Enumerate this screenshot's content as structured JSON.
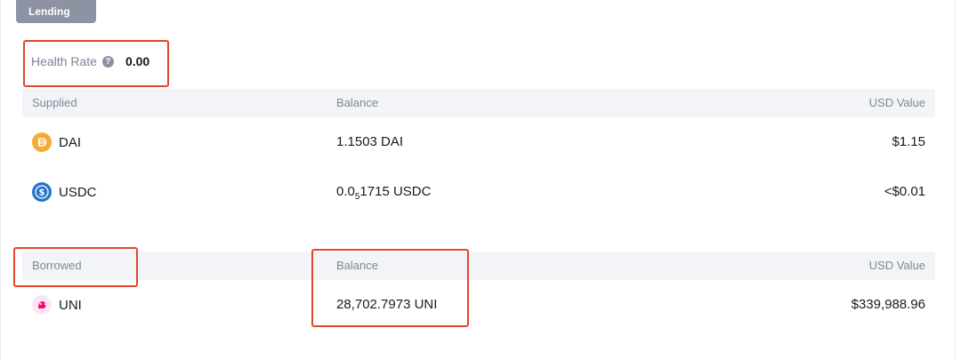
{
  "section_tag": "Lending",
  "health": {
    "label": "Health Rate",
    "help_icon": "question-icon",
    "value": "0.00"
  },
  "supplied": {
    "headers": {
      "asset": "Supplied",
      "balance": "Balance",
      "usd": "USD Value"
    },
    "rows": [
      {
        "symbol": "DAI",
        "icon": "dai-coin-icon",
        "balance": "1.1503 DAI",
        "usd": "$1.15"
      },
      {
        "symbol": "USDC",
        "icon": "usdc-coin-icon",
        "balance_prefix": "0.0",
        "balance_sub": "5",
        "balance_suffix": "1715 USDC",
        "usd": "<$0.01"
      }
    ]
  },
  "borrowed": {
    "headers": {
      "asset": "Borrowed",
      "balance": "Balance",
      "usd": "USD Value"
    },
    "rows": [
      {
        "symbol": "UNI",
        "icon": "uni-coin-icon",
        "balance": "28,702.7973 UNI",
        "usd": "$339,988.96"
      }
    ]
  },
  "colors": {
    "tag_bg": "#8d93a3",
    "annotation_red": "#e34530",
    "header_bg": "#f2f4f8",
    "dai": "#f5ac37",
    "usdc": "#2775ca",
    "uni": "#ff007a"
  }
}
